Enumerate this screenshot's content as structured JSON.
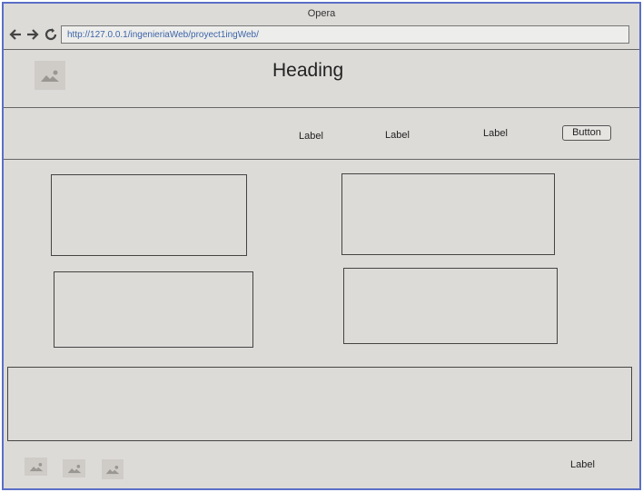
{
  "browser": {
    "title": "Opera",
    "url": "http://127.0.0.1/ingenieriaWeb/proyect1ingWeb/"
  },
  "header": {
    "heading": "Heading"
  },
  "nav": {
    "labels": [
      "Label",
      "Label",
      "Label"
    ],
    "button": "Button"
  },
  "footer": {
    "label": "Label"
  },
  "icons": {
    "back": "arrow-left-icon",
    "forward": "arrow-right-icon",
    "reload": "reload-icon",
    "image": "image-placeholder-icon"
  }
}
